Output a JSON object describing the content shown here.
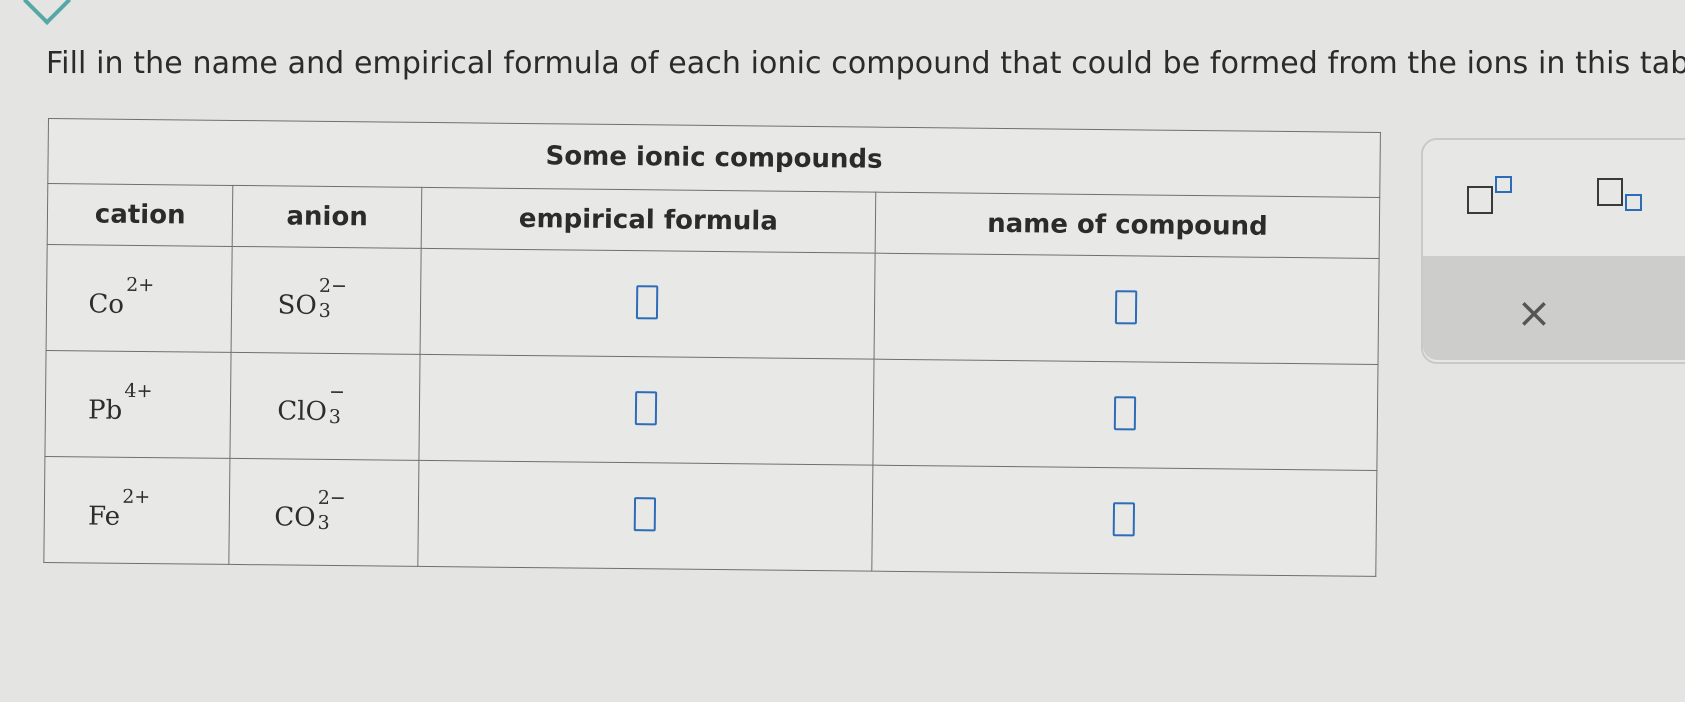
{
  "prompt": "Fill in the name and empirical formula of each ionic compound that could be formed from the ions in this table:",
  "table": {
    "title": "Some ionic compounds",
    "headers": {
      "cation": "cation",
      "anion": "anion",
      "formula": "empirical formula",
      "name": "name of compound"
    },
    "rows": [
      {
        "cation": {
          "symbol": "Co",
          "charge": "2+"
        },
        "anion": {
          "symbol": "SO",
          "subscript": "3",
          "charge": "2−"
        }
      },
      {
        "cation": {
          "symbol": "Pb",
          "charge": "4+"
        },
        "anion": {
          "symbol": "ClO",
          "subscript": "3",
          "charge": "−"
        }
      },
      {
        "cation": {
          "symbol": "Fe",
          "charge": "2+"
        },
        "anion": {
          "symbol": "CO",
          "subscript": "3",
          "charge": "2−"
        }
      }
    ]
  },
  "palette": {
    "buttons": [
      "superscript-icon",
      "subscript-icon"
    ],
    "clear_label": "×"
  },
  "colors": {
    "background": "#e4e5e3",
    "answer_box": "#2c6cb8",
    "teal_accent": "#56a7a5",
    "clear_bar": "#cdcecc"
  }
}
